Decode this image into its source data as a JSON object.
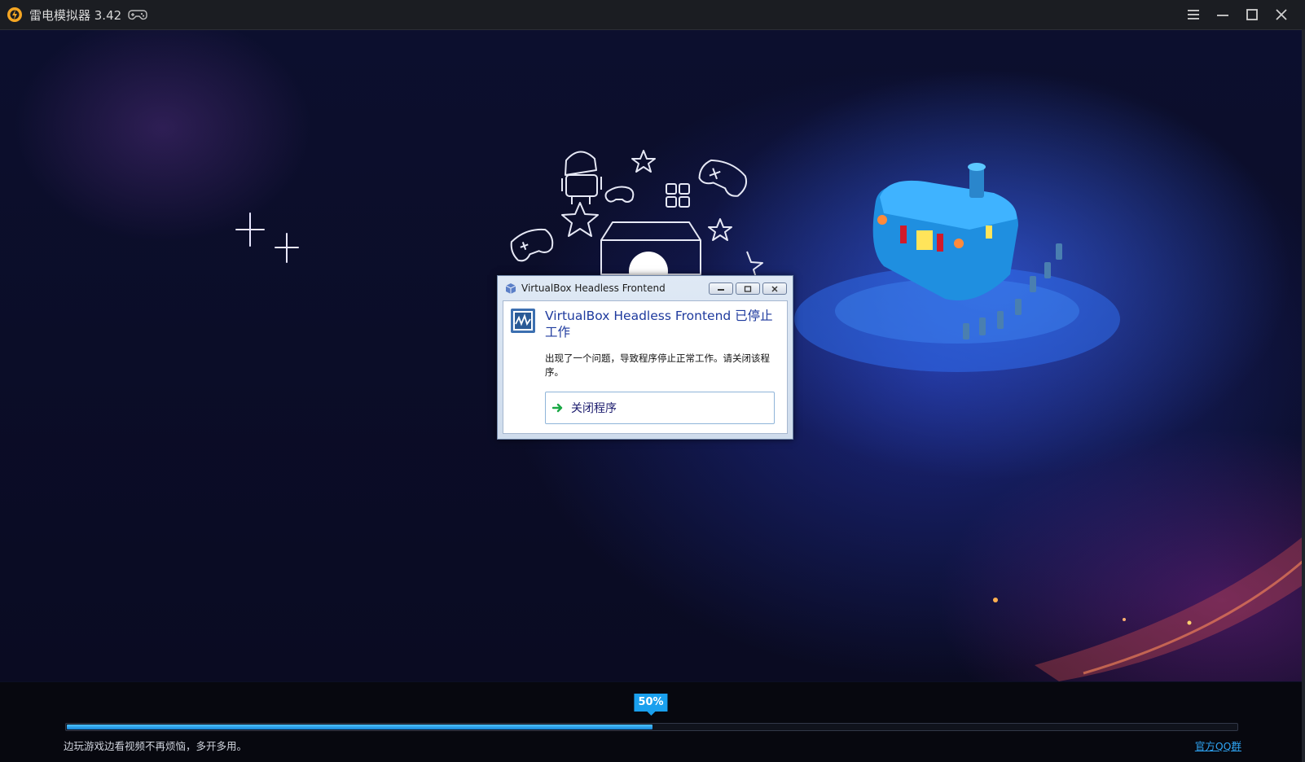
{
  "titlebar": {
    "title": "雷电模拟器 3.42",
    "logo_icon": "ldplayer-logo-icon",
    "gamepad_icon": "gamepad-icon",
    "menu_icon": "menu-icon",
    "minimize_icon": "minimize-icon",
    "maximize_icon": "maximize-icon",
    "close_icon": "close-icon"
  },
  "dialog": {
    "title": "VirtualBox Headless Frontend",
    "heading": "VirtualBox Headless Frontend 已停止工作",
    "message": "出现了一个问题，导致程序停止正常工作。请关闭该程序。",
    "command_label": "关闭程序",
    "controls": [
      "minimize",
      "restore",
      "close"
    ]
  },
  "footer": {
    "progress_percent": 50,
    "progress_label": "50%",
    "tip": "边玩游戏边看视频不再烦恼，多开多用。",
    "qq_link": "官方QQ群"
  },
  "colors": {
    "accent": "#1aa0ee",
    "titlebar_bg": "#1b1d22",
    "dialog_heading": "#1e3a9e",
    "link": "#2ea2f0"
  }
}
